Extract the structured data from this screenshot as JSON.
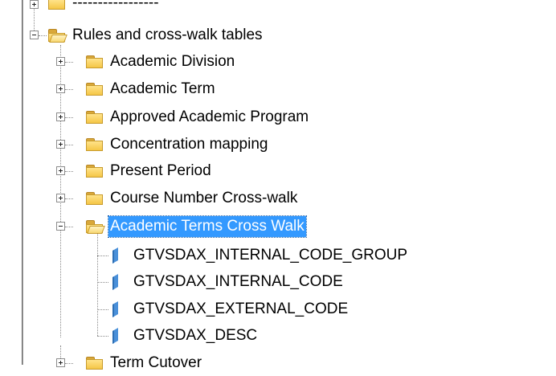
{
  "tree": {
    "top_item": {
      "label": "-----------------"
    },
    "rules_folder": {
      "label": "Rules and cross-walk tables"
    },
    "children": [
      {
        "label": "Academic Division"
      },
      {
        "label": "Academic Term"
      },
      {
        "label": "Approved Academic Program"
      },
      {
        "label": "Concentration mapping"
      },
      {
        "label": "Present Period"
      },
      {
        "label": "Course Number Cross-walk"
      }
    ],
    "selected_folder": {
      "label": "Academic Terms Cross Walk",
      "fields": [
        {
          "label": "GTVSDAX_INTERNAL_CODE_GROUP"
        },
        {
          "label": "GTVSDAX_INTERNAL_CODE"
        },
        {
          "label": "GTVSDAX_EXTERNAL_CODE"
        },
        {
          "label": "GTVSDAX_DESC"
        }
      ]
    },
    "bottom_item": {
      "label": "Term Cutover"
    }
  },
  "icons": {
    "folder": "folder-icon",
    "open_folder": "open-folder-icon",
    "field": "field-icon"
  },
  "colors": {
    "selection": "#3399ff",
    "folder": "#f5c646",
    "field_icon": "#4a90d9"
  }
}
